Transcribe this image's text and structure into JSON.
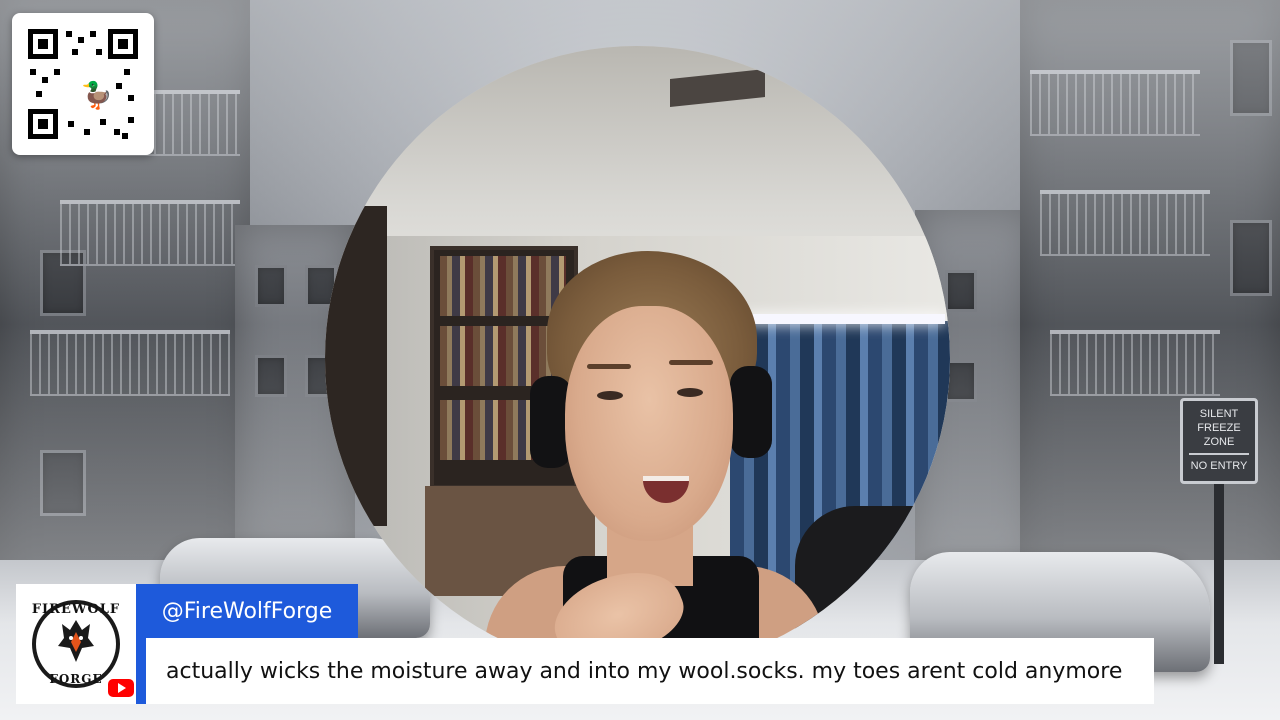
{
  "stream": {
    "username": "@FireWolfForge",
    "caption": "actually wicks the moisture away and into my wool.socks. my toes arent cold anymore"
  },
  "logo": {
    "top_text": "FIREWOLF",
    "bottom_text": "FORGE"
  },
  "background": {
    "sign_line1": "SILENT",
    "sign_line2": "FREEZE",
    "sign_line3": "ZONE",
    "sign_line4": "NO ENTRY"
  },
  "colors": {
    "accent_blue": "#1e5adb",
    "youtube_red": "#ff0000"
  },
  "icons": {
    "qr": "qr-code-icon",
    "duck": "duck-icon",
    "youtube": "youtube-icon",
    "wolf": "wolf-icon"
  }
}
